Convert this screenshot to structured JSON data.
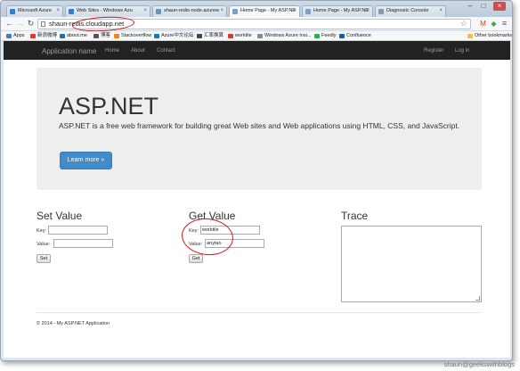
{
  "browser": {
    "tabs": [
      {
        "title": "Microsoft Azure",
        "color": "#2f7fd3"
      },
      {
        "title": "Web Sites - Windows Azu",
        "color": "#3a7ccf"
      },
      {
        "title": "shaun-redis-node.azurew",
        "color": "#6a8fb8"
      },
      {
        "title": "Home Page - My ASP.NE",
        "color": "#7aa0c8"
      },
      {
        "title": "Home Page - My ASP.NE",
        "color": "#7aa0c8"
      },
      {
        "title": "Diagnostic Console",
        "color": "#8a9aaa"
      }
    ],
    "url": "shaun-redis.cloudapp.net",
    "bookmarks": [
      {
        "label": "Apps",
        "color": "#4c7ac0"
      },
      {
        "label": "新浪微博",
        "color": "#d83b2f"
      },
      {
        "label": "about.me",
        "color": "#2a6da6"
      },
      {
        "label": "博客",
        "color": "#555555"
      },
      {
        "label": "Stackoverflow",
        "color": "#f48024"
      },
      {
        "label": "Azure中文论坛",
        "color": "#1e73be"
      },
      {
        "label": "汇率换算",
        "color": "#444444"
      },
      {
        "label": "worktile",
        "color": "#d83b2f"
      },
      {
        "label": "Windows Azure Insi...",
        "color": "#8a8a8a"
      },
      {
        "label": "Feedly",
        "color": "#2bb24c"
      },
      {
        "label": "Confluence",
        "color": "#1f5aa6"
      }
    ],
    "other_bookmarks": "Other bookmarks"
  },
  "navbar": {
    "brand": "Application name",
    "links": [
      "Home",
      "About",
      "Contact"
    ],
    "right_links": [
      "Register",
      "Log in"
    ]
  },
  "jumbotron": {
    "title": "ASP.NET",
    "lead": "ASP.NET is a free web framework for building great Web sites and Web applications using HTML, CSS, and JavaScript.",
    "button": "Learn more »"
  },
  "set": {
    "title": "Set Value",
    "key_label": "Key:",
    "key_value": "",
    "value_label": "Value:",
    "value_value": "",
    "button": "Set"
  },
  "get": {
    "title": "Get Value",
    "key_label": "Key:",
    "key_value": "worktile",
    "value_label": "Value:",
    "value_value": "anytao",
    "button": "Get"
  },
  "trace": {
    "title": "Trace",
    "content": ""
  },
  "footer": "© 2014 - My ASP.NET Application",
  "watermark": "shaun@geekswithblogs",
  "colors": {
    "navbar_bg": "#222222",
    "jumbotron_bg": "#eeeeee",
    "primary_button": "#428bca",
    "annotation_red": "#d2151a"
  }
}
